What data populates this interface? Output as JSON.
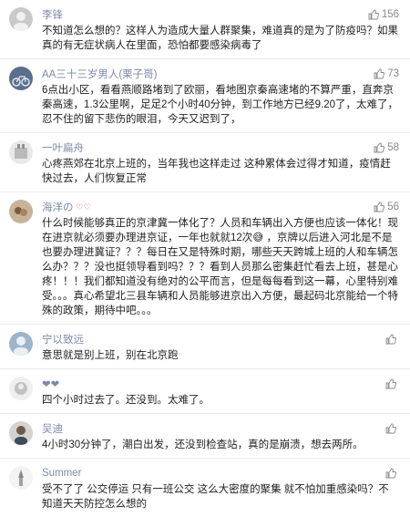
{
  "comments": [
    {
      "user": "李锋",
      "likes": "156",
      "text": "不知道怎么想的？这样人为造成大量人群聚集，难道真的是为了防疫吗？如果真的有无症状病人在里面，恐怕都要感染病毒了"
    },
    {
      "user": "AA三十三岁男人(栗子哥)",
      "likes": "73",
      "text": "6点出小区，看看燕顺路堵到了欧丽，看地图京秦高速堵的不算严重，直奔京秦高速，1.3公里啊，足足2个小时40分钟，到工作地方已经9.20了，太难了，忍不住的留下悲伤的眼泪，今天又迟到了，"
    },
    {
      "user": "一叶扁舟",
      "likes": "58",
      "text": "心疼燕郊在北京上班的，当年我也这样走过 这种累体会过得才知道，疫情赶快过去，人们恢复正常"
    },
    {
      "user": "海洋の",
      "likes": "56",
      "text": "什么时候能够真正的京津冀一体化了？人员和车辆出入方便也应该一体化！现在进京就必须要办理进京证，一年也就就12次😅 ，京牌以后进入河北是不是也要办理进冀证？？？每日在又是特殊时期，哪些天天跨城上班的人和车辆怎么办？？？没也挺领导看到吗？？？看到人员那么密集赶忙看去上班，甚是心疼！！！我们都知道没有绝对的公平而言，但是每每看到这一幕，心里特别难受。。。真心希望北三县车辆和人员能够进京出入方便，最起码北京能给一个特殊的政策，期待中吧。。。"
    },
    {
      "user": "宁以致远",
      "likes": "",
      "text": "意思就是别上班，别在北京跑"
    },
    {
      "user": "❤❤",
      "likes": "",
      "text": "四个小时过去了。还没到。太难了。"
    },
    {
      "user": "吴迪",
      "likes": "",
      "text": "4小时30分钟了，潮白出发，还没到检查站，真的是崩溃，想去两所。"
    },
    {
      "user": "Summer",
      "likes": "",
      "text": "受不了了 公交停运 只有一班公交 这么大密度的聚集 就不怕加重感染吗？不知道天天防控怎么想的"
    }
  ],
  "badge_text": "♡♡"
}
